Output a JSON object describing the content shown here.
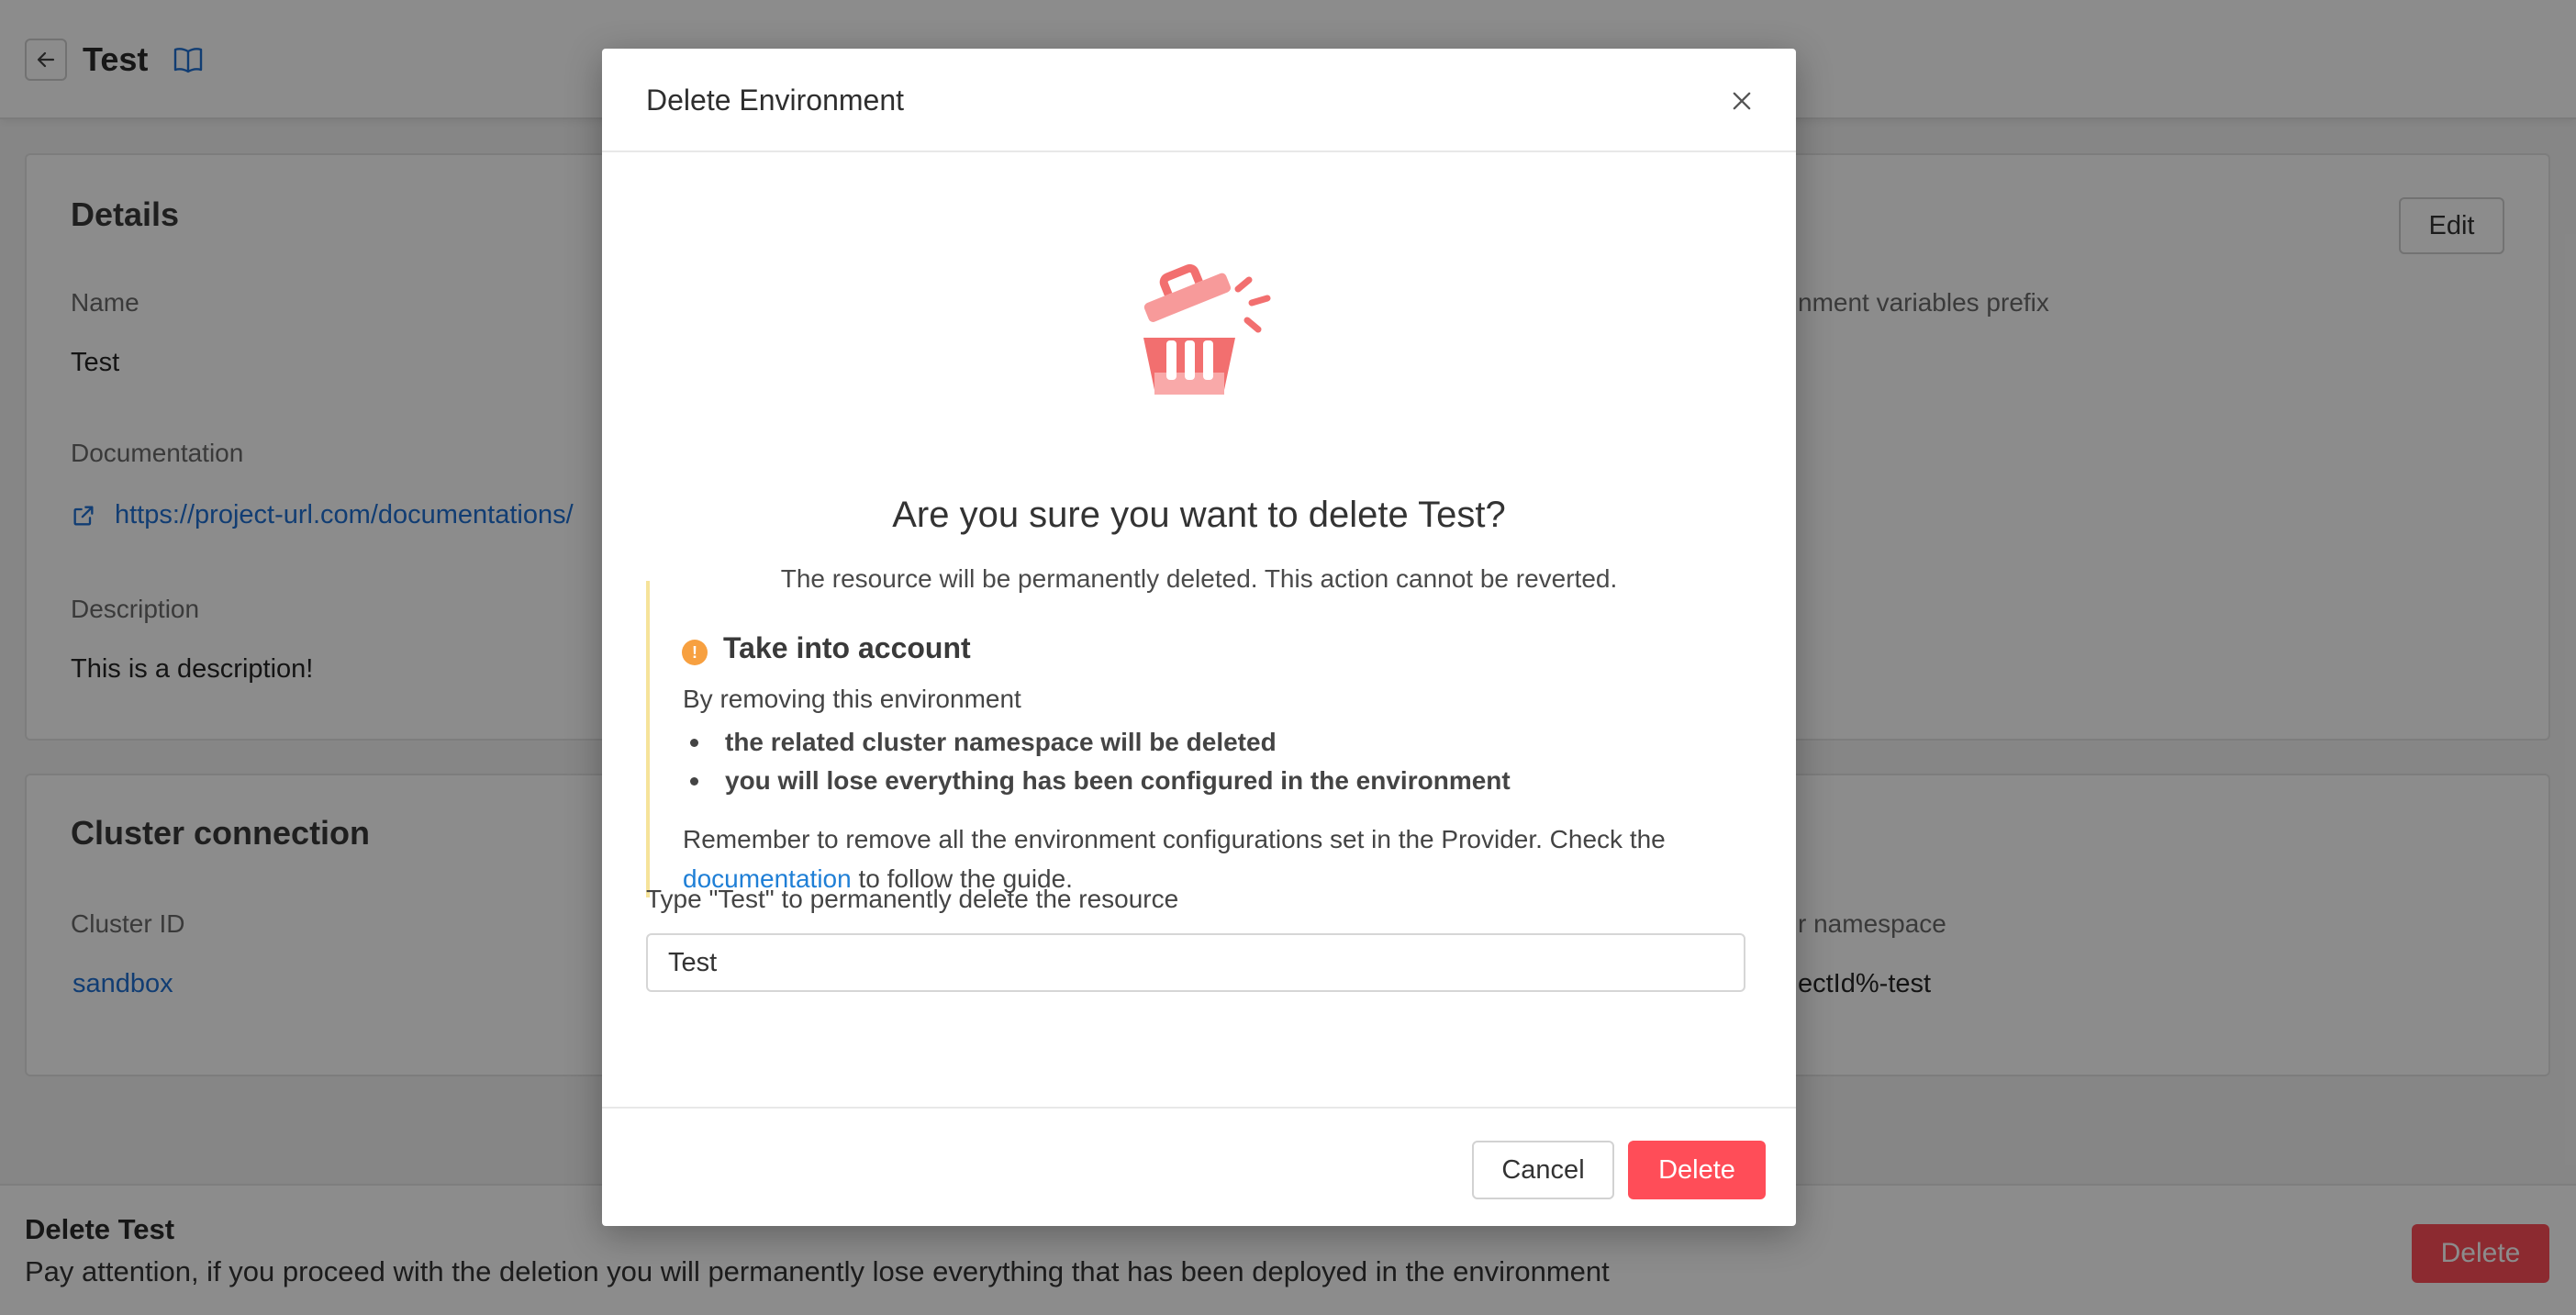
{
  "header": {
    "title": "Test",
    "back_icon": "arrow-left-icon",
    "docs_icon": "book-icon"
  },
  "details": {
    "title": "Details",
    "edit_label": "Edit",
    "name_label": "Name",
    "name_value": "Test",
    "documentation_label": "Documentation",
    "documentation_url": "https://project-url.com/documentations/",
    "description_label": "Description",
    "description_value": "This is a description!",
    "env_vars_prefix_label": "nment variables prefix"
  },
  "cluster": {
    "title": "Cluster connection",
    "cluster_id_label": "Cluster ID",
    "cluster_id_value": "sandbox",
    "namespace_label": "r namespace",
    "namespace_value": "ectId%-test"
  },
  "danger": {
    "title": "Delete Test",
    "text": "Pay attention, if you proceed with the deletion you will permanently lose everything that has been deployed in the environment",
    "button_label": "Delete"
  },
  "modal": {
    "title": "Delete Environment",
    "question": "Are you sure you want to delete Test?",
    "subtitle": "The resource will be permanently deleted. This action cannot be reverted.",
    "alert": {
      "title": "Take into account",
      "icon": "!",
      "intro": "By removing this environment",
      "items": [
        "the related cluster namespace will be deleted",
        "you will lose everything has been configured in the environment"
      ],
      "note_before": "Remember to remove all the environment configurations set in the Provider. Check the",
      "note_link": "documentation",
      "note_after": "to follow the guide."
    },
    "type_label": "Type \"Test\" to permanently delete the resource",
    "input_value": "Test",
    "cancel_label": "Cancel",
    "delete_label": "Delete"
  },
  "colors": {
    "danger": "#ff4d58",
    "link": "#1f6fd1",
    "warning": "#f7a040",
    "alert_border": "#f6e39a"
  }
}
